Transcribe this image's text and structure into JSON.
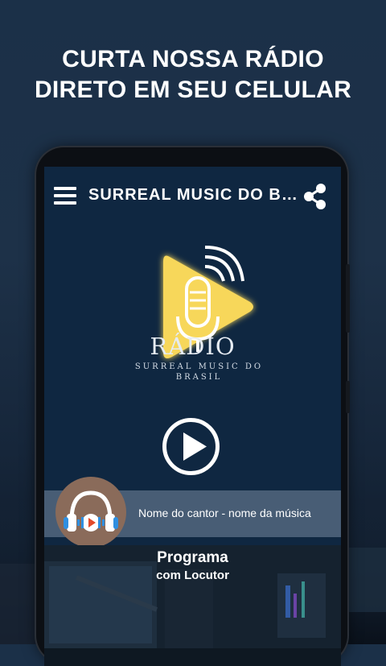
{
  "headline": {
    "line1": "CURTA NOSSA RÁDIO",
    "line2": "DIRETO EM SEU CELULAR"
  },
  "app": {
    "title": "SURREAL MUSIC DO BRASIL",
    "logo_word": "RÁDIO",
    "logo_brand_line1": "SURREAL MUSIC DO",
    "logo_brand_line2": "BRASIL",
    "icons": {
      "menu": "menu-icon",
      "share": "share-icon",
      "play": "play-icon",
      "headphones": "headphones-icon"
    }
  },
  "player": {
    "song_info": "Nome do cantor - nome da música",
    "program_name": "Programa",
    "program_host": "com Locutor"
  },
  "colors": {
    "background": "#1b3048",
    "screen": "#0f2741",
    "logo_yellow": "#f7d75a",
    "accent_red": "#e24a2b",
    "headphones_blue": "#2f8fe0"
  }
}
